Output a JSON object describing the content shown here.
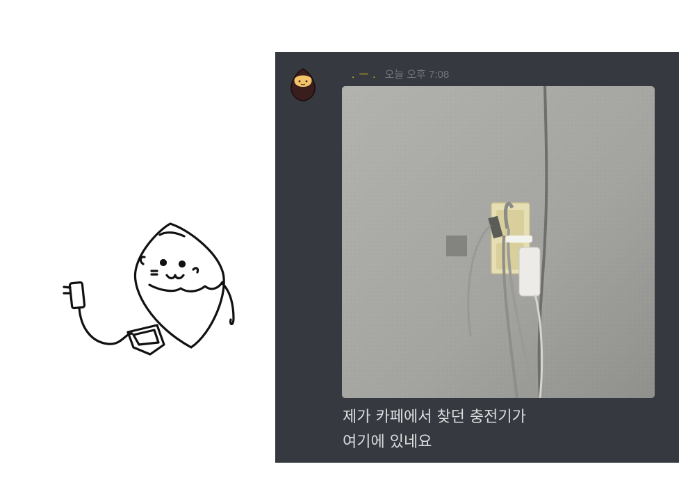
{
  "message": {
    "username": ". ㅡ  .",
    "timestamp": "오늘 오후 7:08",
    "text_lines": [
      "제가 카페에서 찾던 충전기가",
      "여기에 있네요"
    ]
  },
  "colors": {
    "panel_bg": "#36393f",
    "username": "#f1c40f",
    "timestamp": "#72767d",
    "text": "#dcddde"
  },
  "icons": {
    "avatar": "sweet-potato-avatar-icon",
    "sticker": "sweet-potato-charger-sticker"
  }
}
